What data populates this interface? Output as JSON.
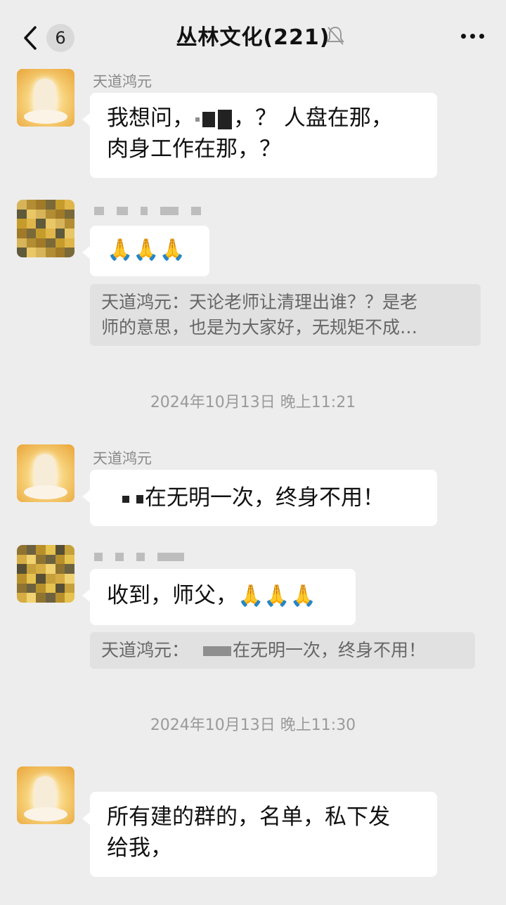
{
  "header": {
    "back_count": "6",
    "title": "丛林文化(221)"
  },
  "messages": [
    {
      "sender": "天道鸿元",
      "line1_a": "我想问，",
      "line1_b": "，？ 人盘在那，",
      "line2": "肉身工作在那，？"
    },
    {
      "emoji": "🙏🙏🙏",
      "quote_line1": "天道鸿元：天论老师让清理出谁？？是老",
      "quote_line2": "师的意思，也是为大家好，无规矩不成…"
    },
    {
      "timestamp": "2024年10月13日 晚上11:21"
    },
    {
      "sender": "天道鸿元",
      "text": "在无明一次，终身不用！"
    },
    {
      "text": "收到，师父，",
      "emoji": "🙏🙏🙏",
      "quote_prefix": "天道鸿元：",
      "quote_text": "在无明一次，终身不用！"
    },
    {
      "timestamp": "2024年10月13日 晚上11:30"
    },
    {
      "line1": "所有建的群的，名单，私下发",
      "line2": "给我，"
    }
  ],
  "colors": {
    "background": "#ededed",
    "bubble": "#ffffff",
    "quote": "#e1e1e1",
    "meta_text": "#9a9a9a"
  },
  "icons": [
    "back-chevron-icon",
    "mute-bell-icon",
    "more-icon",
    "folded-hands-emoji"
  ]
}
